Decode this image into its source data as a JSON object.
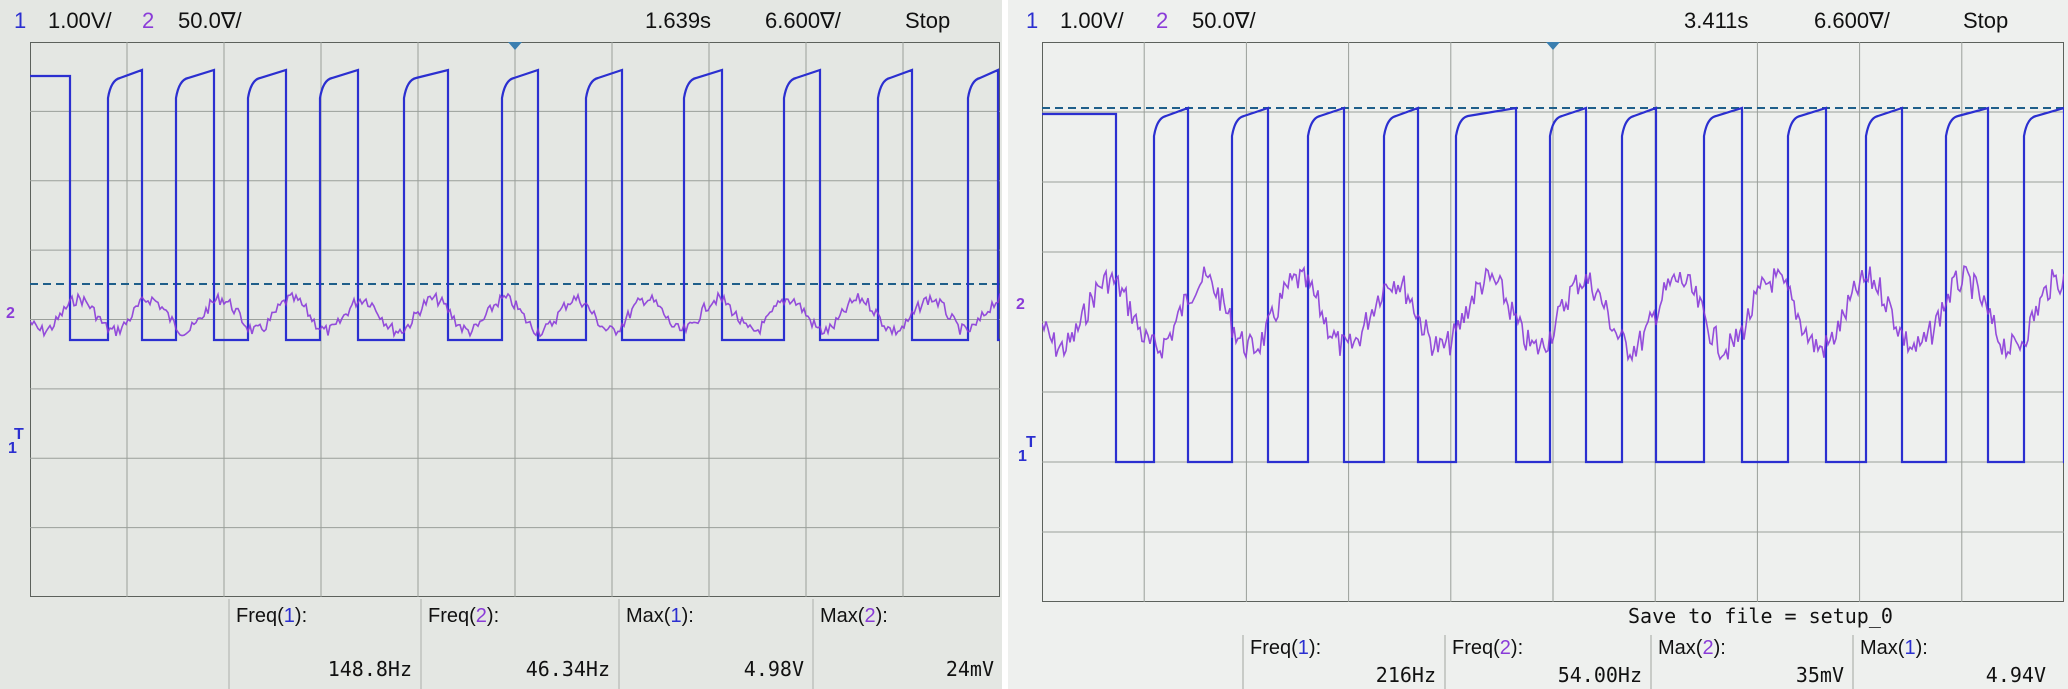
{
  "left": {
    "ch1_num": "1",
    "ch1_scale": "1.00V/",
    "ch2_num": "2",
    "ch2_scale": "50.0∇/",
    "time_pos": "1.639s",
    "time_scale": "6.600∇/",
    "status": "Stop",
    "ch2_marker": "2",
    "ch1_marker": "1",
    "trigger_marker": "T",
    "measurements": [
      {
        "name": "Freq",
        "ch": "1",
        "value": "148.8Hz"
      },
      {
        "name": "Freq",
        "ch": "2",
        "value": "46.34Hz"
      },
      {
        "name": "Max",
        "ch": "1",
        "value": "4.98V"
      },
      {
        "name": "Max",
        "ch": "2",
        "value": "24mV"
      }
    ],
    "ch1_freq": 148.8,
    "ch2_freq": 46.34
  },
  "right": {
    "ch1_num": "1",
    "ch1_scale": "1.00V/",
    "ch2_num": "2",
    "ch2_scale": "50.0∇/",
    "time_pos": "3.411s",
    "time_scale": "6.600∇/",
    "status": "Stop",
    "ch2_marker": "2",
    "ch1_marker": "1",
    "trigger_marker": "T",
    "save_message": "Save to file = setup_0",
    "measurements": [
      {
        "name": "Freq",
        "ch": "1",
        "value": "216Hz"
      },
      {
        "name": "Freq",
        "ch": "2",
        "value": "54.00Hz"
      },
      {
        "name": "Max",
        "ch": "2",
        "value": "35mV"
      },
      {
        "name": "Max",
        "ch": "1",
        "value": "4.94V"
      }
    ],
    "ch1_freq": 216,
    "ch2_freq": 54.0
  },
  "colors": {
    "ch1": "#2b2fd0",
    "ch2": "#8a3bd8",
    "trigger_level": "#1f5f8a",
    "grid": "#9a9f9a"
  }
}
